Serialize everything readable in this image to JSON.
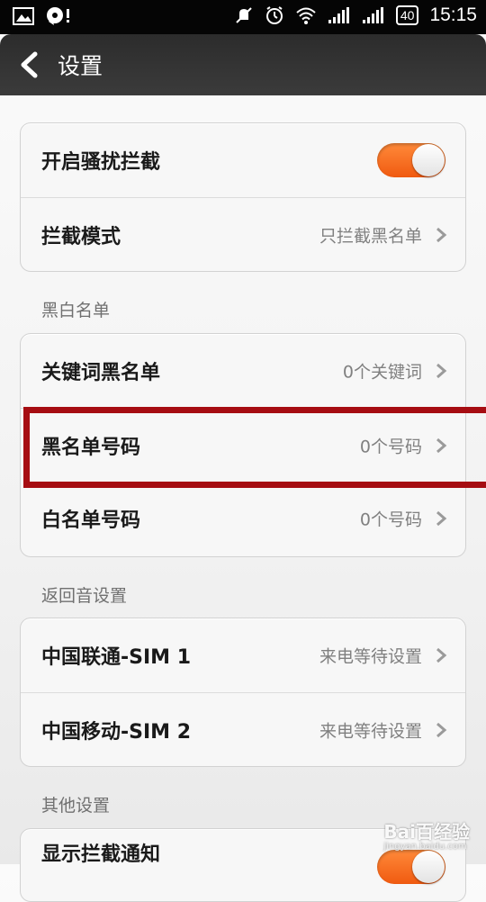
{
  "status_bar": {
    "time": "15:15",
    "battery": "40",
    "left_icons": [
      "image-icon",
      "chat-notification-icon"
    ],
    "right_icons": [
      "mute-icon",
      "alarm-icon",
      "wifi-icon",
      "signal-icon",
      "signal-icon"
    ]
  },
  "header": {
    "title": "设置",
    "back_icon": "chevron-left-icon"
  },
  "card1": {
    "rows": [
      {
        "label": "开启骚扰拦截",
        "toggle_on": true
      },
      {
        "label": "拦截模式",
        "value": "只拦截黑名单"
      }
    ]
  },
  "section_blacklist": "黑白名单",
  "card2": {
    "rows": [
      {
        "label": "关键词黑名单",
        "value": "0个关键词"
      },
      {
        "label": "黑名单号码",
        "value": "0个号码"
      },
      {
        "label": "白名单号码",
        "value": "0个号码"
      }
    ]
  },
  "section_ringback": "返回音设置",
  "card3": {
    "rows": [
      {
        "label": "中国联通-SIM 1",
        "value": "来电等待设置"
      },
      {
        "label": "中国移动-SIM 2",
        "value": "来电等待设置"
      }
    ]
  },
  "section_other": "其他设置",
  "card4": {
    "rows": [
      {
        "label": "显示拦截通知",
        "toggle_on": true
      }
    ]
  },
  "watermark": {
    "text": "Bai百经验",
    "sub": "jingyan.baidu.com"
  },
  "colors": {
    "accent": "#f26a1b",
    "highlight_box": "#a60d12",
    "titlebar": "#333333"
  }
}
